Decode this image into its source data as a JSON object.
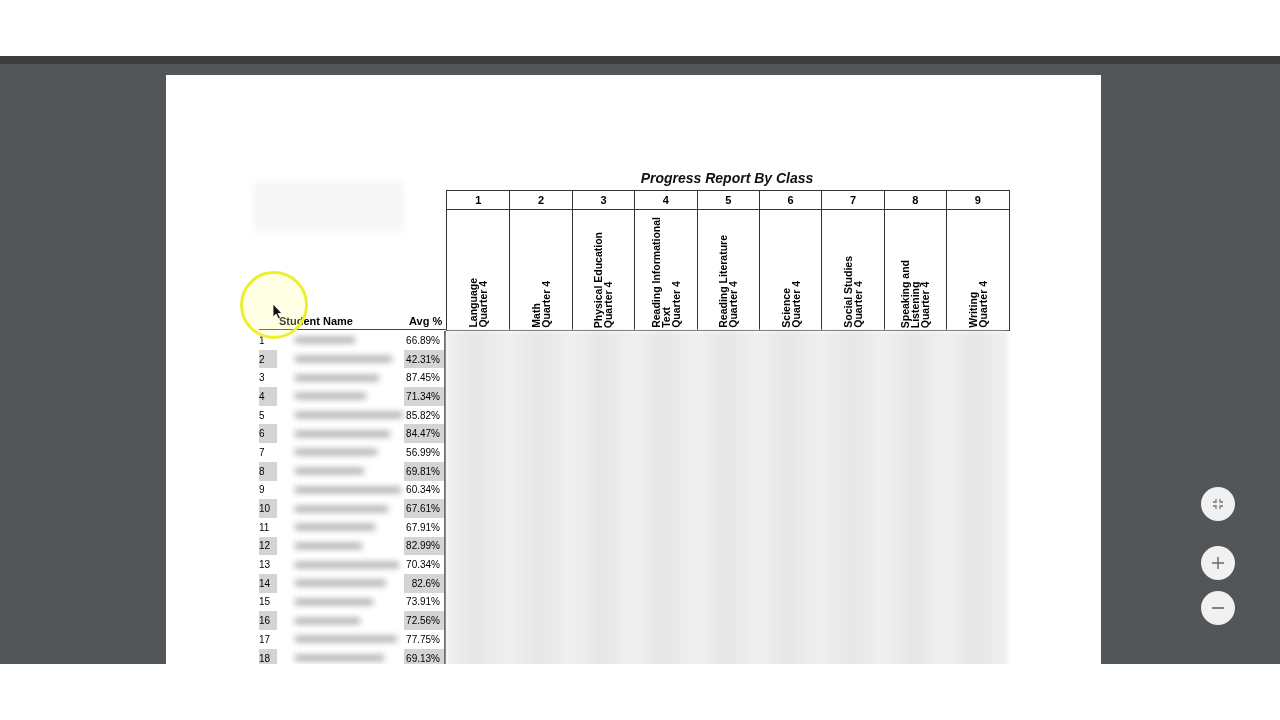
{
  "report": {
    "title": "Progress Report By Class",
    "name_header": "Student Name",
    "avg_header": "Avg %",
    "columns": [
      {
        "number": "1",
        "lines": [
          "Language",
          "Quarter 4"
        ]
      },
      {
        "number": "2",
        "lines": [
          "Math",
          "Quarter 4"
        ]
      },
      {
        "number": "3",
        "lines": [
          "Physical Education",
          "Quarter 4"
        ]
      },
      {
        "number": "4",
        "lines": [
          "Reading Informational",
          "Text",
          "Quarter 4"
        ]
      },
      {
        "number": "5",
        "lines": [
          "Reading Literature",
          "Quarter 4"
        ]
      },
      {
        "number": "6",
        "lines": [
          "Science",
          "Quarter 4"
        ]
      },
      {
        "number": "7",
        "lines": [
          "Social Studies",
          "Quarter 4"
        ]
      },
      {
        "number": "8",
        "lines": [
          "Speaking and",
          "Listening",
          "Quarter 4"
        ]
      },
      {
        "number": "9",
        "lines": [
          "Writing",
          "Quarter 4"
        ]
      }
    ],
    "rows": [
      {
        "index": "1",
        "avg": "66.89%"
      },
      {
        "index": "2",
        "avg": "42.31%"
      },
      {
        "index": "3",
        "avg": "87.45%"
      },
      {
        "index": "4",
        "avg": "71.34%"
      },
      {
        "index": "5",
        "avg": "85.82%"
      },
      {
        "index": "6",
        "avg": "84.47%"
      },
      {
        "index": "7",
        "avg": "56.99%"
      },
      {
        "index": "8",
        "avg": "69.81%"
      },
      {
        "index": "9",
        "avg": "60.34%"
      },
      {
        "index": "10",
        "avg": "67.61%"
      },
      {
        "index": "11",
        "avg": "67.91%"
      },
      {
        "index": "12",
        "avg": "82.99%"
      },
      {
        "index": "13",
        "avg": "70.34%"
      },
      {
        "index": "14",
        "avg": "82.6%"
      },
      {
        "index": "15",
        "avg": "73.91%"
      },
      {
        "index": "16",
        "avg": "72.56%"
      },
      {
        "index": "17",
        "avg": "77.75%"
      },
      {
        "index": "18",
        "avg": "69.13%"
      }
    ]
  },
  "controls": [
    {
      "kind": "fit"
    },
    {
      "kind": "zoom_in"
    },
    {
      "kind": "zoom_out"
    }
  ]
}
